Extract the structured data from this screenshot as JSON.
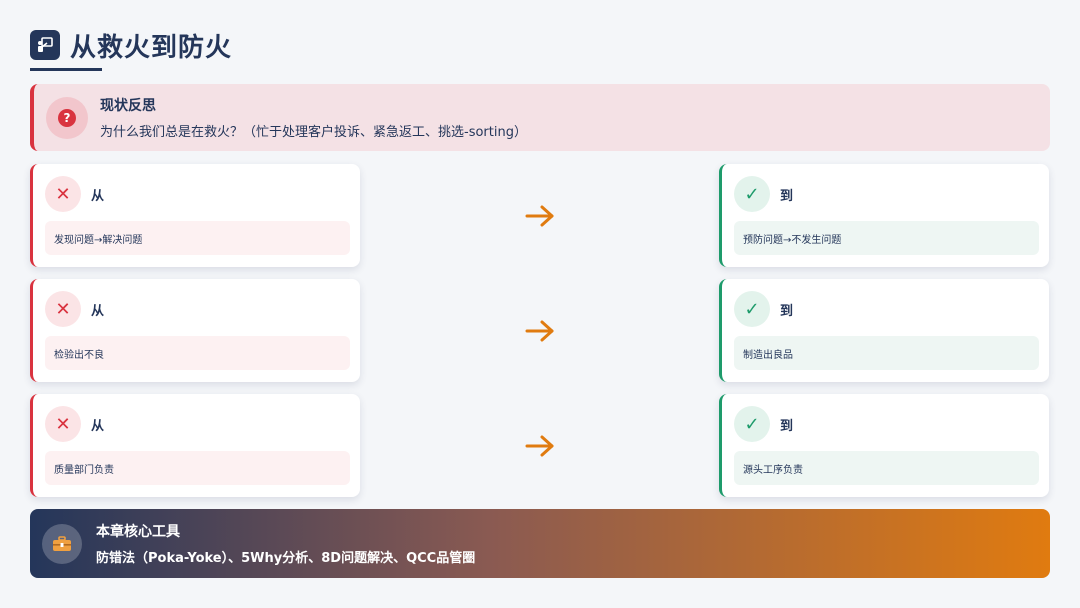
{
  "header": {
    "title": "从救火到防火",
    "icon": "chalkboard-teacher-icon"
  },
  "reflection": {
    "title": "现状反思",
    "text": "为什么我们总是在救火？（忙于处理客户投诉、紧急返工、挑选-sorting）",
    "icon": "question-circle-icon"
  },
  "comparisons": [
    {
      "from_label": "从",
      "from_text": "发现问题→解决问题",
      "to_label": "到",
      "to_text": "预防问题→不发生问题"
    },
    {
      "from_label": "从",
      "from_text": "检验出不良",
      "to_label": "到",
      "to_text": "制造出良品"
    },
    {
      "from_label": "从",
      "from_text": "质量部门负责",
      "to_label": "到",
      "to_text": "源头工序负责"
    }
  ],
  "footer": {
    "title": "本章核心工具",
    "text": "防错法（Poka-Yoke）、5Why分析、8D问题解决、QCC品管圈",
    "icon": "toolbox-icon"
  },
  "colors": {
    "navy": "#24365a",
    "red": "#d9333f",
    "green": "#1e9b6b",
    "orange": "#e07b10"
  }
}
